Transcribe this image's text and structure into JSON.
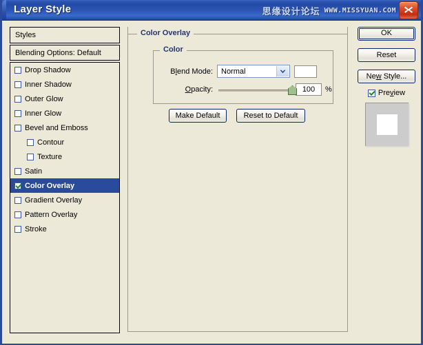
{
  "window": {
    "title": "Layer Style",
    "close_icon": "close-x-icon",
    "watermark_cn": "思缘设计论坛",
    "watermark_url": "WWW.MISSYUAN.COM",
    "accent_title": "#2a53b4",
    "accent_selection": "#2a4b9b",
    "accent_legend": "#24356e"
  },
  "styles_panel": {
    "header": "Styles",
    "blending_options": "Blending Options: Default",
    "effects": [
      {
        "label": "Drop Shadow",
        "checked": false,
        "indented": false,
        "selected": false
      },
      {
        "label": "Inner Shadow",
        "checked": false,
        "indented": false,
        "selected": false
      },
      {
        "label": "Outer Glow",
        "checked": false,
        "indented": false,
        "selected": false
      },
      {
        "label": "Inner Glow",
        "checked": false,
        "indented": false,
        "selected": false
      },
      {
        "label": "Bevel and Emboss",
        "checked": false,
        "indented": false,
        "selected": false
      },
      {
        "label": "Contour",
        "checked": false,
        "indented": true,
        "selected": false
      },
      {
        "label": "Texture",
        "checked": false,
        "indented": true,
        "selected": false
      },
      {
        "label": "Satin",
        "checked": false,
        "indented": false,
        "selected": false
      },
      {
        "label": "Color Overlay",
        "checked": true,
        "indented": false,
        "selected": true
      },
      {
        "label": "Gradient Overlay",
        "checked": false,
        "indented": false,
        "selected": false
      },
      {
        "label": "Pattern Overlay",
        "checked": false,
        "indented": false,
        "selected": false
      },
      {
        "label": "Stroke",
        "checked": false,
        "indented": false,
        "selected": false
      }
    ]
  },
  "settings": {
    "group_title": "Color Overlay",
    "color_group_title": "Color",
    "blend_mode": {
      "label_pre": "B",
      "label_accel": "l",
      "label_post": "end Mode:",
      "value": "Normal",
      "swatch_color": "#ffffff",
      "arrow_icon": "chevron-down-icon"
    },
    "opacity": {
      "label_pre": "",
      "label_accel": "O",
      "label_post": "pacity:",
      "value": "100",
      "unit": "%",
      "percent": 100
    },
    "make_default": "Make Default",
    "reset_to_default": "Reset to Default"
  },
  "right_panel": {
    "ok": "OK",
    "reset": "Reset",
    "new_style_pre": "Ne",
    "new_style_accel": "w",
    "new_style_post": " Style...",
    "preview_pre": "Pre",
    "preview_accel": "v",
    "preview_post": "iew",
    "preview_checked": true,
    "thumb_bg": "#cccccc",
    "thumb_fg": "#ffffff"
  }
}
